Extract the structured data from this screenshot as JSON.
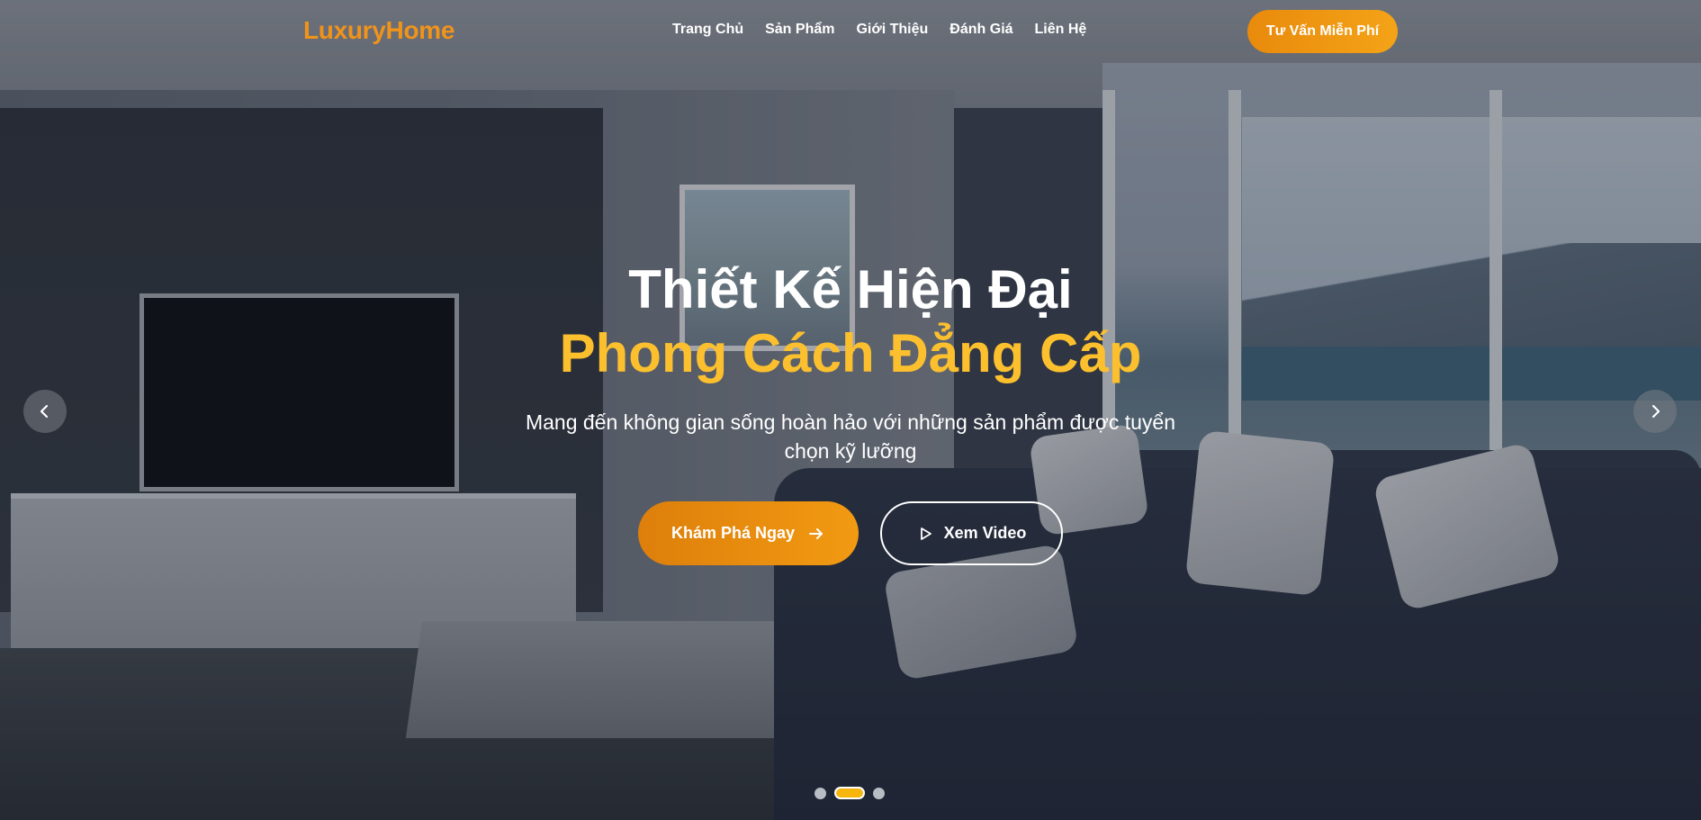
{
  "header": {
    "logo": "LuxuryHome",
    "nav": [
      "Trang Chủ",
      "Sản Phẩm",
      "Giới Thiệu",
      "Đánh Giá",
      "Liên Hệ"
    ],
    "cta_label": "Tư Vấn Miễn Phí"
  },
  "hero": {
    "title_line1": "Thiết Kế Hiện Đại",
    "title_line2": "Phong Cách Đẳng Cấp",
    "subtitle": "Mang đến không gian sống hoàn hảo với những sản phẩm được tuyển chọn kỹ lưỡng",
    "primary_button": "Khám Phá Ngay",
    "secondary_button": "Xem Video"
  },
  "carousel": {
    "slide_count": 3,
    "active_slide": 2,
    "prev_icon": "chevron-left-icon",
    "next_icon": "chevron-right-icon"
  },
  "colors": {
    "brand_orange": "#f0931a",
    "accent_yellow": "#fcc02e",
    "text_white": "#ffffff"
  }
}
